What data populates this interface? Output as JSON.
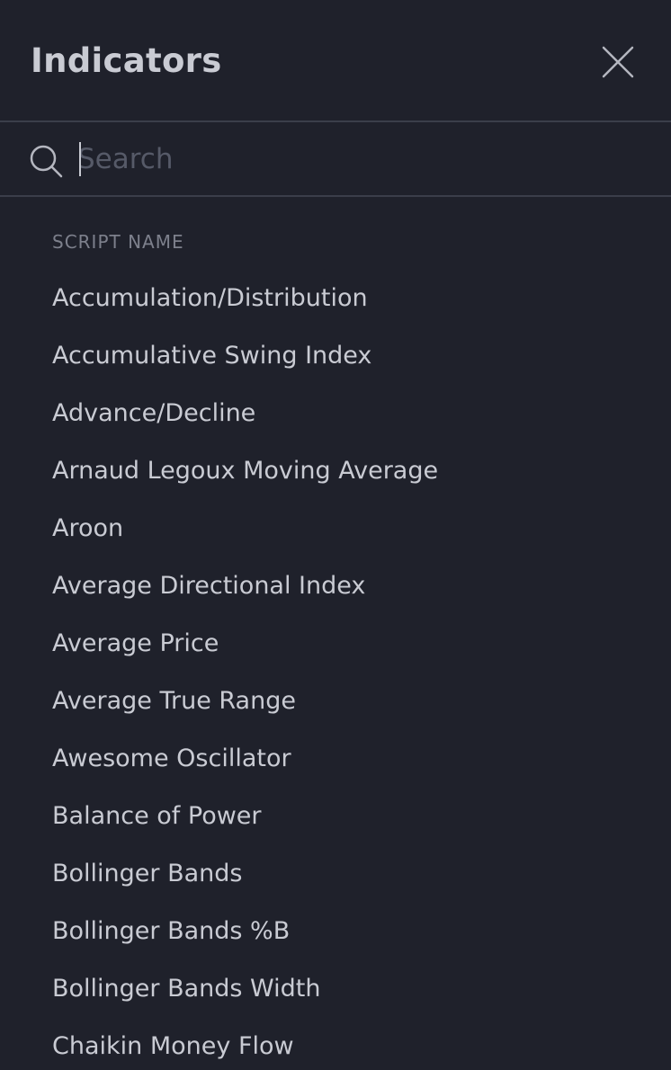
{
  "header": {
    "title": "Indicators",
    "close_icon": "close-icon"
  },
  "search": {
    "placeholder": "Search",
    "value": "",
    "icon": "search-icon"
  },
  "list": {
    "section_label": "SCRIPT NAME",
    "items": [
      "Accumulation/Distribution",
      "Accumulative Swing Index",
      "Advance/Decline",
      "Arnaud Legoux Moving Average",
      "Aroon",
      "Average Directional Index",
      "Average Price",
      "Average True Range",
      "Awesome Oscillator",
      "Balance of Power",
      "Bollinger Bands",
      "Bollinger Bands %B",
      "Bollinger Bands Width",
      "Chaikin Money Flow"
    ]
  },
  "colors": {
    "background": "#1f212b",
    "text": "#c9cbd3",
    "muted": "#7d808c",
    "divider": "#3b3e4a"
  }
}
